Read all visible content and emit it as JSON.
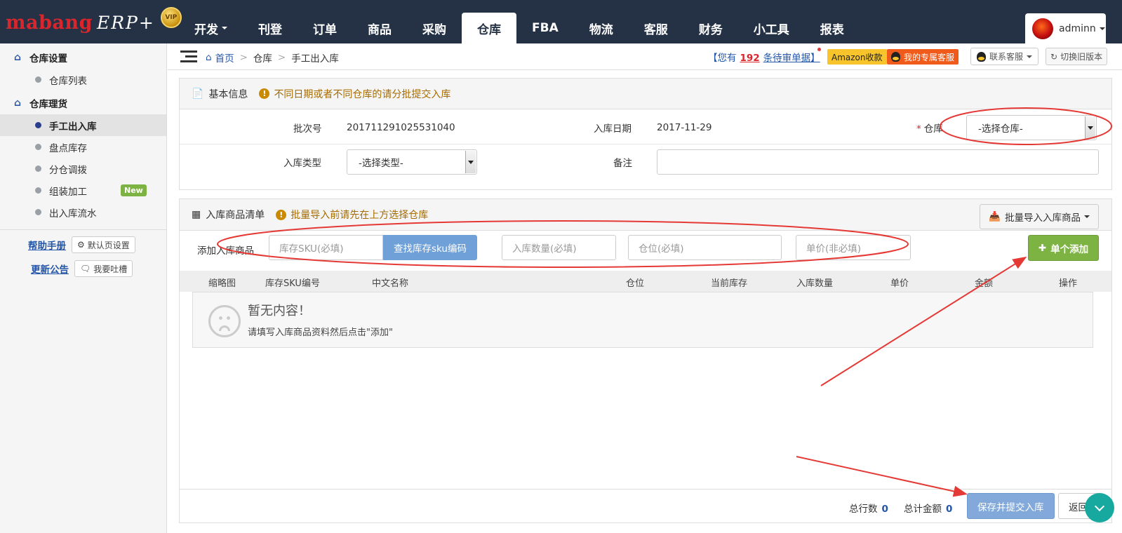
{
  "brand": {
    "name": "mabang",
    "product": "ERP+",
    "vip": "VIP"
  },
  "nav": {
    "items": [
      {
        "label": "开发",
        "has_caret": true
      },
      {
        "label": "刊登"
      },
      {
        "label": "订单"
      },
      {
        "label": "商品"
      },
      {
        "label": "采购"
      },
      {
        "label": "仓库",
        "active": true
      },
      {
        "label": "FBA"
      },
      {
        "label": "物流"
      },
      {
        "label": "客服"
      },
      {
        "label": "财务"
      },
      {
        "label": "小工具"
      },
      {
        "label": "报表"
      }
    ],
    "user": "adminn"
  },
  "sidebar": {
    "groups": [
      {
        "title": "仓库设置",
        "items": [
          {
            "label": "仓库列表"
          }
        ]
      },
      {
        "title": "仓库理货",
        "items": [
          {
            "label": "手工出入库",
            "active": true
          },
          {
            "label": "盘点库存"
          },
          {
            "label": "分仓调拨"
          },
          {
            "label": "组装加工",
            "badge": "New"
          },
          {
            "label": "出入库流水"
          }
        ]
      }
    ],
    "help_link": "帮助手册",
    "default_page_btn": "默认页设置",
    "news_link": "更新公告",
    "feedback_btn": "我要吐槽"
  },
  "breadcrumb": {
    "home": "首页",
    "level1": "仓库",
    "current": "手工出入库"
  },
  "topright": {
    "pending_prefix": "【您有",
    "pending_count": "192",
    "pending_suffix": "条待审单据】",
    "amazon_btn": "Amazon收款",
    "service_btn": "我的专属客服",
    "contact_btn": "联系客服",
    "old_version_btn": "切换旧版本"
  },
  "basic": {
    "title": "基本信息",
    "warning": "不同日期或者不同仓库的请分批提交入库",
    "batch_label": "批次号",
    "batch_value": "201711291025531040",
    "date_label": "入库日期",
    "date_value": "2017-11-29",
    "warehouse_label": "仓库",
    "warehouse_required": "*",
    "warehouse_select": "-选择仓库-",
    "type_label": "入库类型",
    "type_select": "-选择类型-",
    "remark_label": "备注",
    "remark_value": ""
  },
  "goods": {
    "title": "入库商品清单",
    "warning": "批量导入前请先在上方选择仓库",
    "import_btn": "批量导入入库商品",
    "add_label": "添加入库商品",
    "sku_placeholder": "库存SKU(必填)",
    "find_btn": "查找库存sku编码",
    "qty_placeholder": "入库数量(必填)",
    "location_placeholder": "仓位(必填)",
    "price_placeholder": "单价(非必填)",
    "add_single_btn": "单个添加",
    "columns": [
      "缩略图",
      "库存SKU编号",
      "中文名称",
      "仓位",
      "当前库存",
      "入库数量",
      "单价",
      "金额",
      "操作"
    ],
    "empty_title": "暂无内容！",
    "empty_sub": "请填写入库商品资料然后点击\"添加\""
  },
  "footer": {
    "rows_label": "总行数",
    "rows_value": "0",
    "amount_label": "总计金额",
    "amount_value": "0",
    "save_btn": "保存并提交入库",
    "back_btn": "返回"
  },
  "colors": {
    "nav_bg": "#253245",
    "accent_red": "#d9262c",
    "success": "#7cb342",
    "primary": "#6fa0d8",
    "annotation": "#e53935"
  }
}
